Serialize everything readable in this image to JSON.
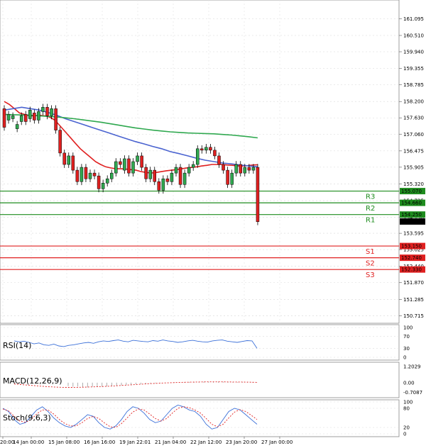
{
  "chart_data": [
    {
      "type": "candlestick",
      "ylim": [
        150.6,
        161.6
      ],
      "y_ticks": [
        "161.095",
        "160.510",
        "159.940",
        "159.355",
        "158.785",
        "158.200",
        "157.630",
        "157.060",
        "156.475",
        "155.905",
        "155.320",
        "154.735",
        "154.150",
        "153.595",
        "153.025",
        "152.440",
        "151.870",
        "151.285",
        "150.715"
      ],
      "x_tick_labels": [
        "20:00",
        "14 Jan 00:00",
        "15 Jan 08:00",
        "16 Jan 16:00",
        "19 Jan 22:01",
        "21 Jan 04:00",
        "22 Jan 12:00",
        "23 Jan 20:00",
        "27 Jan 00:00"
      ],
      "candles": [
        [
          0,
          157.95,
          157.3
        ],
        [
          1,
          157.55,
          157.75
        ],
        [
          2,
          157.6,
          157.7
        ],
        [
          3,
          157.25,
          157.4
        ],
        [
          4,
          157.5,
          157.7
        ],
        [
          5,
          157.75,
          157.5
        ],
        [
          6,
          157.6,
          157.9
        ],
        [
          7,
          157.8,
          157.55
        ],
        [
          8,
          157.55,
          157.85
        ],
        [
          9,
          157.85,
          158.0
        ],
        [
          10,
          158.0,
          157.7
        ],
        [
          11,
          157.7,
          157.95
        ],
        [
          12,
          157.95,
          157.2
        ],
        [
          13,
          157.2,
          156.4
        ],
        [
          14,
          156.4,
          156.0
        ],
        [
          15,
          156.0,
          156.3
        ],
        [
          16,
          156.3,
          155.8
        ],
        [
          17,
          155.8,
          155.4
        ],
        [
          18,
          155.4,
          155.9
        ],
        [
          19,
          155.9,
          155.5
        ],
        [
          20,
          155.5,
          155.7
        ],
        [
          21,
          155.7,
          155.6
        ],
        [
          22,
          155.6,
          155.15
        ],
        [
          23,
          155.15,
          155.35
        ],
        [
          24,
          155.35,
          155.5
        ],
        [
          25,
          155.5,
          155.7
        ],
        [
          26,
          155.7,
          156.1
        ],
        [
          27,
          156.1,
          156.0
        ],
        [
          28,
          155.8,
          156.2
        ],
        [
          29,
          156.2,
          155.7
        ],
        [
          30,
          155.7,
          156.1
        ],
        [
          31,
          156.1,
          156.3
        ],
        [
          32,
          156.3,
          155.9
        ],
        [
          33,
          155.9,
          155.5
        ],
        [
          34,
          155.5,
          155.8
        ],
        [
          35,
          155.8,
          155.4
        ],
        [
          36,
          155.4,
          155.1
        ],
        [
          37,
          155.1,
          155.5
        ],
        [
          38,
          155.5,
          155.4
        ],
        [
          39,
          155.4,
          155.7
        ],
        [
          40,
          155.7,
          155.9
        ],
        [
          41,
          155.9,
          155.3
        ],
        [
          42,
          155.3,
          155.7
        ],
        [
          43,
          155.7,
          155.9
        ],
        [
          44,
          155.9,
          156.0
        ],
        [
          45,
          156.0,
          156.55
        ],
        [
          46,
          156.55,
          156.5
        ],
        [
          47,
          156.5,
          156.6
        ],
        [
          48,
          156.6,
          156.5
        ],
        [
          49,
          156.5,
          156.3
        ],
        [
          50,
          156.3,
          156.0
        ],
        [
          51,
          156.0,
          155.8
        ],
        [
          52,
          155.8,
          155.3
        ],
        [
          53,
          155.3,
          155.7
        ],
        [
          54,
          155.7,
          156.0
        ],
        [
          55,
          156.0,
          155.7
        ],
        [
          56,
          155.7,
          155.9
        ],
        [
          57,
          155.9,
          155.8
        ],
        [
          58,
          155.8,
          155.9
        ],
        [
          59,
          155.9,
          154.0
        ]
      ],
      "moving_averages": [
        {
          "color": "#e02020",
          "values": [
            158.2,
            158.1,
            157.95,
            157.8,
            157.75,
            157.7,
            157.7,
            157.72,
            157.7,
            157.65,
            157.55,
            157.35,
            157.15,
            156.95,
            156.75,
            156.55,
            156.4,
            156.25,
            156.1,
            156.0,
            155.92,
            155.88,
            155.85,
            155.85,
            155.84,
            155.82,
            155.8,
            155.75,
            155.72,
            155.7,
            155.72,
            155.75,
            155.78,
            155.8,
            155.82,
            155.85,
            155.88,
            155.9,
            155.92,
            155.95,
            155.97,
            156.0,
            156.0,
            156.0,
            155.98,
            155.97,
            155.95,
            155.95,
            155.96,
            155.98,
            155.99
          ]
        },
        {
          "color": "#4a63d0",
          "values": [
            157.9,
            157.95,
            158.0,
            157.95,
            157.9,
            157.82,
            157.72,
            157.6,
            157.5,
            157.4,
            157.3,
            157.2,
            157.1,
            157.0,
            156.9,
            156.8,
            156.72,
            156.63,
            156.55,
            156.45,
            156.38,
            156.3,
            156.22,
            156.15,
            156.1,
            156.05,
            156.02,
            155.98,
            155.95,
            155.92
          ]
        },
        {
          "color": "#2fa84f",
          "values": [
            157.75,
            157.74,
            157.73,
            157.72,
            157.7,
            157.68,
            157.66,
            157.63,
            157.6,
            157.56,
            157.52,
            157.48,
            157.43,
            157.38,
            157.33,
            157.28,
            157.24,
            157.2,
            157.17,
            157.14,
            157.12,
            157.1,
            157.09,
            157.08,
            157.07,
            157.05,
            157.03,
            157.0,
            156.97,
            156.93
          ]
        }
      ],
      "levels": [
        {
          "label": "R3",
          "value": 155.07,
          "price_label": "155.070",
          "color": "#1e8c1e"
        },
        {
          "label": "R2",
          "value": 154.66,
          "price_label": "154.660",
          "color": "#1e8c1e"
        },
        {
          "label": "R1",
          "value": 154.25,
          "price_label": "154.250",
          "color": "#1e8c1e"
        },
        {
          "label": "S1",
          "value": 153.15,
          "price_label": "153.150",
          "color": "#e02020"
        },
        {
          "label": "S2",
          "value": 152.74,
          "price_label": "152.740",
          "color": "#e02020"
        },
        {
          "label": "S3",
          "value": 152.33,
          "price_label": "152.330",
          "color": "#e02020"
        }
      ],
      "current_price_label": "154.008"
    },
    {
      "type": "line",
      "title": "RSI(14)",
      "y_ticks": [
        "100",
        "70",
        "30",
        "0"
      ],
      "ylim": [
        0,
        100
      ],
      "values": [
        55,
        52,
        54,
        50,
        45,
        48,
        42,
        40,
        44,
        38,
        36,
        40,
        42,
        45,
        48,
        50,
        47,
        52,
        55,
        53,
        56,
        58,
        54,
        52,
        57,
        55,
        53,
        52,
        56,
        54,
        58,
        55,
        53,
        50,
        52,
        55,
        57,
        54,
        52,
        51,
        55,
        57,
        58,
        54,
        52,
        50,
        53,
        56,
        55,
        30
      ]
    },
    {
      "type": "line",
      "title": "MACD(12,26,9)",
      "y_ticks": [
        "1.2029",
        "0.00",
        "-0.7087"
      ],
      "ylim": [
        -0.9,
        1.3
      ],
      "histogram": [
        -0.25,
        -0.3,
        -0.28,
        -0.32,
        -0.35,
        -0.3,
        -0.28,
        -0.3,
        -0.27,
        -0.25,
        -0.22,
        -0.2,
        -0.18,
        -0.15,
        -0.12,
        -0.1,
        -0.08,
        -0.06,
        -0.05,
        -0.03,
        -0.02,
        0.0,
        0.02,
        0.03,
        0.04,
        0.05,
        0.06,
        0.07,
        0.06,
        0.05,
        0.06,
        0.07,
        0.06,
        0.05,
        0.05,
        0.04,
        0.03,
        0.03,
        0.02,
        0.01
      ],
      "signal": [
        -0.1,
        -0.15,
        -0.2,
        -0.25,
        -0.3,
        -0.33,
        -0.35,
        -0.35,
        -0.34,
        -0.32,
        -0.3,
        -0.27,
        -0.24,
        -0.2,
        -0.16,
        -0.12,
        -0.08,
        -0.05,
        -0.02,
        0.0,
        0.02,
        0.04,
        0.05,
        0.06,
        0.06,
        0.06,
        0.05,
        0.05,
        0.04,
        0.02
      ]
    },
    {
      "type": "line",
      "title": "Stoch(9,6,3)",
      "y_ticks": [
        "100",
        "80",
        "20",
        "0"
      ],
      "ylim": [
        0,
        100
      ],
      "k": [
        80,
        70,
        45,
        30,
        35,
        55,
        75,
        85,
        70,
        50,
        35,
        25,
        20,
        30,
        45,
        60,
        55,
        35,
        20,
        15,
        25,
        45,
        70,
        85,
        80,
        65,
        45,
        35,
        40,
        60,
        80,
        90,
        85,
        75,
        70,
        55,
        30,
        15,
        20,
        45,
        70,
        80,
        75,
        60,
        45,
        30
      ],
      "d": [
        78,
        72,
        55,
        40,
        36,
        45,
        62,
        75,
        75,
        62,
        45,
        32,
        25,
        25,
        35,
        48,
        55,
        48,
        34,
        22,
        20,
        32,
        50,
        68,
        78,
        75,
        62,
        48,
        40,
        48,
        65,
        80,
        85,
        82,
        75,
        65,
        48,
        30,
        22,
        30,
        50,
        68,
        76,
        70,
        58,
        45
      ]
    }
  ]
}
